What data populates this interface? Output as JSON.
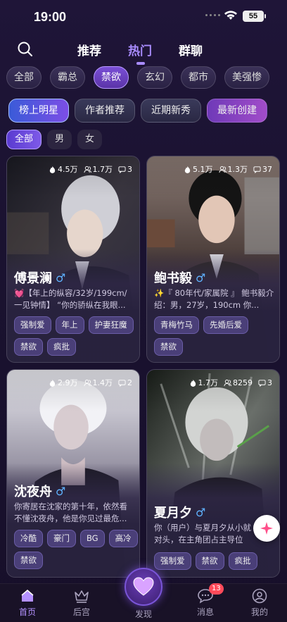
{
  "status_bar": {
    "time": "19:00",
    "battery": "55"
  },
  "top_tabs": [
    {
      "label": "推荐",
      "active": false
    },
    {
      "label": "热门",
      "active": true
    },
    {
      "label": "群聊",
      "active": false
    }
  ],
  "categories": [
    {
      "label": "全部",
      "active": false
    },
    {
      "label": "霸总",
      "active": false
    },
    {
      "label": "禁欲",
      "active": true
    },
    {
      "label": "玄幻",
      "active": false
    },
    {
      "label": "都市",
      "active": false
    },
    {
      "label": "美强惨",
      "active": false
    }
  ],
  "rank_tabs": [
    {
      "label": "榜上明星",
      "active": true
    },
    {
      "label": "作者推荐",
      "active": false
    },
    {
      "label": "近期新秀",
      "active": false
    },
    {
      "label": "最新创建",
      "active": false
    }
  ],
  "gender_filters": [
    {
      "label": "全部",
      "active": true
    },
    {
      "label": "男",
      "active": false
    },
    {
      "label": "女",
      "active": false
    }
  ],
  "cards": [
    {
      "heat": "4.5万",
      "users": "1.7万",
      "comments": "3",
      "name": "傅景澜",
      "gender_symbol": "♂",
      "desc_emoji": "💓",
      "desc": "【年上的纵容/32岁/199cm/一见钟情】 “你的骄纵在我眼...",
      "tags": [
        "强制爱",
        "年上",
        "护妻狂魔",
        "禁欲",
        "疯批"
      ]
    },
    {
      "heat": "5.1万",
      "users": "1.3万",
      "comments": "37",
      "name": "鲍书毅",
      "gender_symbol": "♂",
      "desc_emoji": "✨",
      "desc": "『 80年代/家属院 』 鲍书毅介绍：男，27岁，190cm 你...",
      "tags": [
        "青梅竹马",
        "先婚后爱",
        "禁欲"
      ]
    },
    {
      "heat": "2.9万",
      "users": "1.4万",
      "comments": "2",
      "name": "沈夜舟",
      "gender_symbol": "♂",
      "desc_emoji": "",
      "desc": "你寄居在沈家的第十年，依然看不懂沈夜舟，他是你见过最危...",
      "tags": [
        "冷酷",
        "豪门",
        "BG",
        "高冷",
        "禁欲"
      ]
    },
    {
      "heat": "1.7万",
      "users": "8259",
      "comments": "3",
      "name": "夏月夕",
      "gender_symbol": "♂",
      "desc_emoji": "",
      "desc": "你（用户）与夏月夕从小就对头，在主角团占主导位置...",
      "tags": [
        "强制爱",
        "禁欲",
        "疯批"
      ]
    }
  ],
  "bottom_nav": [
    {
      "label": "首页",
      "active": true
    },
    {
      "label": "后宫",
      "active": false
    },
    {
      "label": "发现",
      "active": false
    },
    {
      "label": "消息",
      "active": false
    },
    {
      "label": "我的",
      "active": false
    }
  ],
  "message_badge": "13",
  "colors": {
    "accent": "#a98cff",
    "male": "#5fb2ff",
    "badge": "#ff4a5a"
  }
}
